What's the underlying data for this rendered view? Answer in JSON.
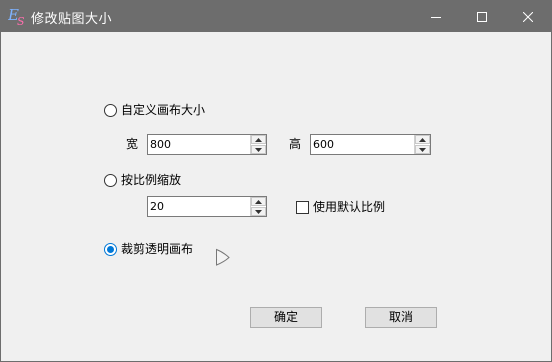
{
  "window": {
    "title": "修改贴图大小",
    "icon": "es-app-icon",
    "controls": [
      "minimize-icon",
      "maximize-icon",
      "close-icon"
    ]
  },
  "options": {
    "custom_canvas": {
      "label": "自定义画布大小",
      "selected": false
    },
    "width_label": "宽",
    "width_value": "800",
    "height_label": "高",
    "height_value": "600",
    "scale": {
      "label": "按比例缩放",
      "selected": false
    },
    "scale_value": "20",
    "default_ratio": {
      "label": "使用默认比例",
      "checked": false
    },
    "crop_transparent": {
      "label": "裁剪透明画布",
      "selected": true
    }
  },
  "buttons": {
    "ok": "确定",
    "cancel": "取消"
  },
  "colors": {
    "titlebar": "#6d6d6d",
    "accent": "#0078d7",
    "background": "#f0f0f0"
  }
}
